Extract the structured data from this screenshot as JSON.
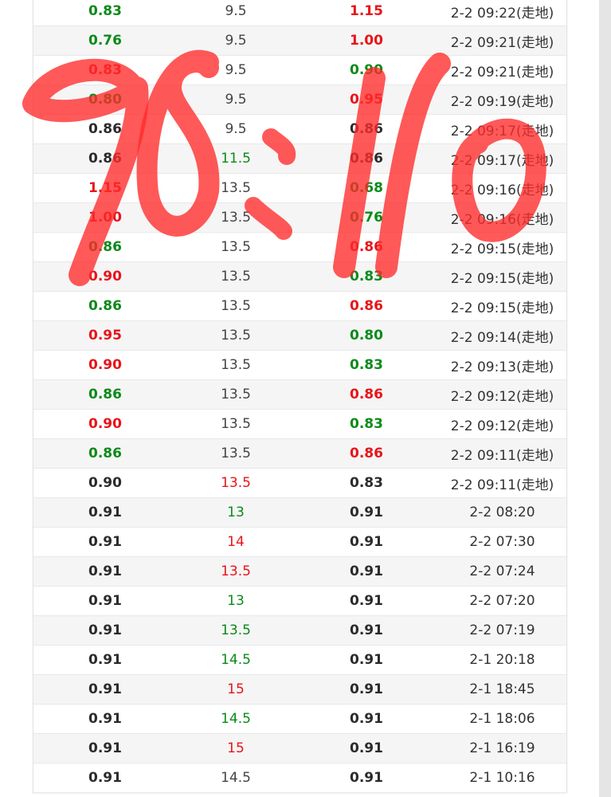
{
  "colors": {
    "green": "#0b8a1a",
    "red": "#e8141a",
    "dark": "#2b2b2b",
    "gray": "#444444",
    "scribble": "#ff2a2a"
  },
  "rows": [
    {
      "home": "0.83",
      "home_color": "green",
      "handicap": "9.5",
      "handicap_color": "gray",
      "away": "1.15",
      "away_color": "red",
      "time": "2-2 09:22(走地)"
    },
    {
      "home": "0.76",
      "home_color": "green",
      "handicap": "9.5",
      "handicap_color": "gray",
      "away": "1.00",
      "away_color": "red",
      "time": "2-2 09:21(走地)"
    },
    {
      "home": "0.83",
      "home_color": "red",
      "handicap": "9.5",
      "handicap_color": "gray",
      "away": "0.90",
      "away_color": "green",
      "time": "2-2 09:21(走地)"
    },
    {
      "home": "0.80",
      "home_color": "green",
      "handicap": "9.5",
      "handicap_color": "gray",
      "away": "0.95",
      "away_color": "red",
      "time": "2-2 09:19(走地)"
    },
    {
      "home": "0.86",
      "home_color": "dark",
      "handicap": "9.5",
      "handicap_color": "gray",
      "away": "0.86",
      "away_color": "dark",
      "time": "2-2 09:17(走地)"
    },
    {
      "home": "0.86",
      "home_color": "dark",
      "handicap": "11.5",
      "handicap_color": "green",
      "away": "0.86",
      "away_color": "dark",
      "time": "2-2 09:17(走地)"
    },
    {
      "home": "1.15",
      "home_color": "red",
      "handicap": "13.5",
      "handicap_color": "gray",
      "away": "0.68",
      "away_color": "green",
      "time": "2-2 09:16(走地)"
    },
    {
      "home": "1.00",
      "home_color": "red",
      "handicap": "13.5",
      "handicap_color": "gray",
      "away": "0.76",
      "away_color": "green",
      "time": "2-2 09:16(走地)"
    },
    {
      "home": "0.86",
      "home_color": "green",
      "handicap": "13.5",
      "handicap_color": "gray",
      "away": "0.86",
      "away_color": "red",
      "time": "2-2 09:15(走地)"
    },
    {
      "home": "0.90",
      "home_color": "red",
      "handicap": "13.5",
      "handicap_color": "gray",
      "away": "0.83",
      "away_color": "green",
      "time": "2-2 09:15(走地)"
    },
    {
      "home": "0.86",
      "home_color": "green",
      "handicap": "13.5",
      "handicap_color": "gray",
      "away": "0.86",
      "away_color": "red",
      "time": "2-2 09:15(走地)"
    },
    {
      "home": "0.95",
      "home_color": "red",
      "handicap": "13.5",
      "handicap_color": "gray",
      "away": "0.80",
      "away_color": "green",
      "time": "2-2 09:14(走地)"
    },
    {
      "home": "0.90",
      "home_color": "red",
      "handicap": "13.5",
      "handicap_color": "gray",
      "away": "0.83",
      "away_color": "green",
      "time": "2-2 09:13(走地)"
    },
    {
      "home": "0.86",
      "home_color": "green",
      "handicap": "13.5",
      "handicap_color": "gray",
      "away": "0.86",
      "away_color": "red",
      "time": "2-2 09:12(走地)"
    },
    {
      "home": "0.90",
      "home_color": "red",
      "handicap": "13.5",
      "handicap_color": "gray",
      "away": "0.83",
      "away_color": "green",
      "time": "2-2 09:12(走地)"
    },
    {
      "home": "0.86",
      "home_color": "green",
      "handicap": "13.5",
      "handicap_color": "gray",
      "away": "0.86",
      "away_color": "red",
      "time": "2-2 09:11(走地)"
    },
    {
      "home": "0.90",
      "home_color": "dark",
      "handicap": "13.5",
      "handicap_color": "red",
      "away": "0.83",
      "away_color": "dark",
      "time": "2-2 09:11(走地)"
    },
    {
      "home": "0.91",
      "home_color": "dark",
      "handicap": "13",
      "handicap_color": "green",
      "away": "0.91",
      "away_color": "dark",
      "time": "2-2 08:20"
    },
    {
      "home": "0.91",
      "home_color": "dark",
      "handicap": "14",
      "handicap_color": "red",
      "away": "0.91",
      "away_color": "dark",
      "time": "2-2 07:30"
    },
    {
      "home": "0.91",
      "home_color": "dark",
      "handicap": "13.5",
      "handicap_color": "red",
      "away": "0.91",
      "away_color": "dark",
      "time": "2-2 07:24"
    },
    {
      "home": "0.91",
      "home_color": "dark",
      "handicap": "13",
      "handicap_color": "green",
      "away": "0.91",
      "away_color": "dark",
      "time": "2-2 07:20"
    },
    {
      "home": "0.91",
      "home_color": "dark",
      "handicap": "13.5",
      "handicap_color": "green",
      "away": "0.91",
      "away_color": "dark",
      "time": "2-2 07:19"
    },
    {
      "home": "0.91",
      "home_color": "dark",
      "handicap": "14.5",
      "handicap_color": "green",
      "away": "0.91",
      "away_color": "dark",
      "time": "2-1 20:18"
    },
    {
      "home": "0.91",
      "home_color": "dark",
      "handicap": "15",
      "handicap_color": "red",
      "away": "0.91",
      "away_color": "dark",
      "time": "2-1 18:45"
    },
    {
      "home": "0.91",
      "home_color": "dark",
      "handicap": "14.5",
      "handicap_color": "green",
      "away": "0.91",
      "away_color": "dark",
      "time": "2-1 18:06"
    },
    {
      "home": "0.91",
      "home_color": "dark",
      "handicap": "15",
      "handicap_color": "red",
      "away": "0.91",
      "away_color": "dark",
      "time": "2-1 16:19"
    },
    {
      "home": "0.91",
      "home_color": "dark",
      "handicap": "14.5",
      "handicap_color": "gray",
      "away": "0.91",
      "away_color": "dark",
      "time": "2-1 10:16"
    }
  ]
}
